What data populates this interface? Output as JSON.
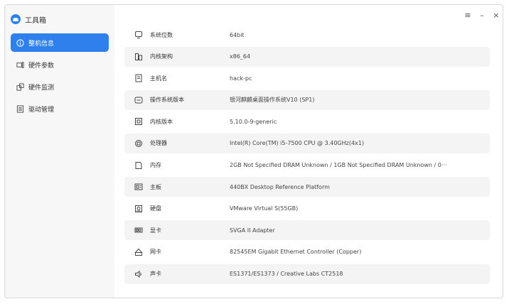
{
  "app": {
    "title": "工具箱"
  },
  "window_controls": {
    "menu": "≡",
    "minimize": "–",
    "close": "×"
  },
  "sidebar": {
    "items": [
      {
        "label": "整机信息",
        "icon": "info-icon",
        "active": true
      },
      {
        "label": "硬件参数",
        "icon": "hardware-icon",
        "active": false
      },
      {
        "label": "硬件监测",
        "icon": "monitor-icon",
        "active": false
      },
      {
        "label": "驱动管理",
        "icon": "driver-icon",
        "active": false
      }
    ]
  },
  "info": {
    "rows": [
      {
        "label": "系统位数",
        "value": "64bit",
        "icon": "cpu-bits-icon"
      },
      {
        "label": "内核架构",
        "value": "x86_64",
        "icon": "kernel-arch-icon"
      },
      {
        "label": "主机名",
        "value": "hack-pc",
        "icon": "host-icon"
      },
      {
        "label": "操作系统版本",
        "value": "银河麒麟桌面操作系统V10 (SP1)",
        "icon": "os-icon"
      },
      {
        "label": "内核版本",
        "value": "5.10.0-9-generic",
        "icon": "kernel-version-icon"
      },
      {
        "label": "处理器",
        "value": "Intel(R) Core(TM) i5-7500 CPU @ 3.40GHz(4x1)",
        "icon": "processor-icon"
      },
      {
        "label": "内存",
        "value": "2GB Not Specified DRAM Unknown / 1GB Not Specified DRAM Unknown / 0···",
        "icon": "memory-icon"
      },
      {
        "label": "主板",
        "value": "440BX Desktop Reference Platform",
        "icon": "motherboard-icon"
      },
      {
        "label": "硬盘",
        "value": "VMware Virtual S(55GB)",
        "icon": "disk-icon"
      },
      {
        "label": "显卡",
        "value": "SVGA II Adapter",
        "icon": "graphics-card-icon"
      },
      {
        "label": "网卡",
        "value": "82545EM Gigabit Ethernet Controller (Copper)",
        "icon": "network-card-icon"
      },
      {
        "label": "声卡",
        "value": "ES1371/ES1373 / Creative Labs CT2518",
        "icon": "sound-card-icon"
      }
    ]
  },
  "colors": {
    "accent": "#2f80ed",
    "sidebar_bg": "#f7f7f7",
    "row_alt": "#f4f4f4"
  }
}
